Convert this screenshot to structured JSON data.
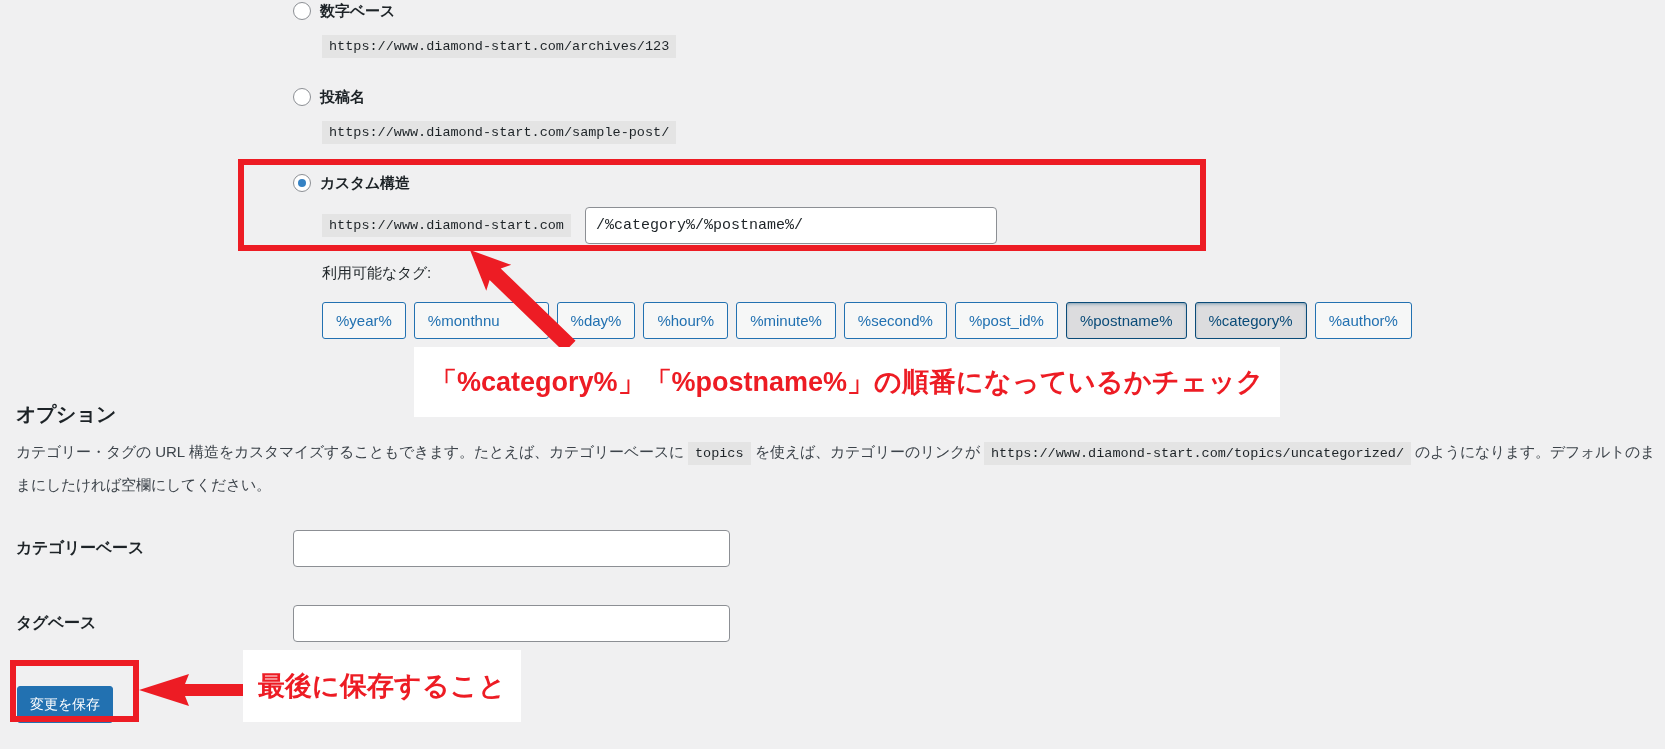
{
  "permalink_options": [
    {
      "label": "数字ベース",
      "example": "https://www.diamond-start.com/archives/123",
      "selected": false
    },
    {
      "label": "投稿名",
      "example": "https://www.diamond-start.com/sample-post/",
      "selected": false
    },
    {
      "label": "カスタム構造",
      "example": "https://www.diamond-start.com",
      "value": "/%category%/%postname%/",
      "selected": true
    }
  ],
  "available_tags_label": "利用可能なタグ:",
  "tags": [
    {
      "label": "%year%",
      "selected": false
    },
    {
      "label": "%monthnu",
      "selected": false
    },
    {
      "label": "%day%",
      "selected": false
    },
    {
      "label": "%hour%",
      "selected": false
    },
    {
      "label": "%minute%",
      "selected": false
    },
    {
      "label": "%second%",
      "selected": false
    },
    {
      "label": "%post_id%",
      "selected": false
    },
    {
      "label": "%postname%",
      "selected": true
    },
    {
      "label": "%category%",
      "selected": true
    },
    {
      "label": "%author%",
      "selected": false
    }
  ],
  "options": {
    "heading": "オプション",
    "description": [
      {
        "kind": "text",
        "text": "カテゴリー・タグの URL 構造をカスタマイズすることもできます。たとえば、カテゴリーベースに "
      },
      {
        "kind": "code",
        "text": "topics"
      },
      {
        "kind": "text",
        "text": " を使えば、カテゴリーのリンクが "
      },
      {
        "kind": "code",
        "text": "https://www.diamond-start.com/topics/uncategorized/"
      },
      {
        "kind": "text",
        "text": " のようになります。デフォルトのままにしたければ空欄にしてください。"
      }
    ]
  },
  "fields": [
    {
      "label": "カテゴリーベース"
    },
    {
      "label": "タグベース"
    }
  ],
  "save_button": "変更を保存",
  "annotations": [
    {
      "text": "「%category%」「%postname%」の順番になっているかチェック"
    },
    {
      "text": "最後に保存すること"
    }
  ]
}
